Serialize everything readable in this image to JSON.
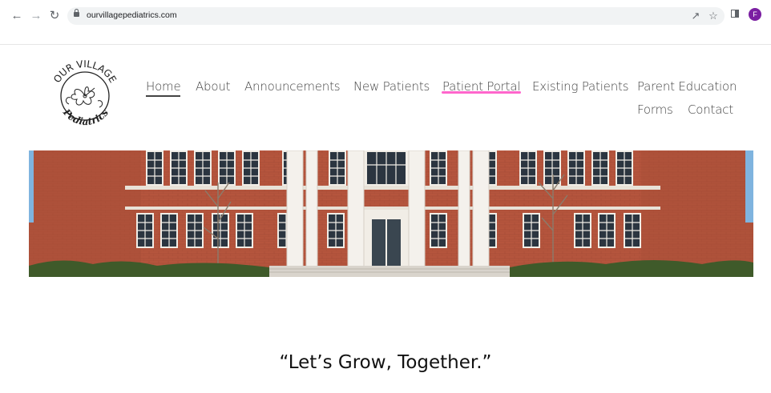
{
  "browser": {
    "url": "ourvillagepediatrics.com",
    "profile_initial": "F",
    "profile_color": "#7b1fa2",
    "icons": [
      "back-arrow-icon",
      "forward-arrow-icon",
      "reload-icon",
      "lock-icon",
      "share-icon",
      "star-icon",
      "side-panel-icon"
    ]
  },
  "site": {
    "logo": {
      "top_text": "OUR VILLAGE",
      "bottom_text": "Pediatrics"
    },
    "nav": {
      "home": "Home",
      "about": "About",
      "announcements": "Announcements",
      "new_patients": "New Patients",
      "patient_portal": "Patient Portal",
      "existing_patients": "Existing Patients",
      "parent_education": "Parent Education",
      "forms": "Forms",
      "contact": "Contact"
    },
    "tagline": "“Let’s Grow, Together.”",
    "colors": {
      "highlight": "#ff66cc",
      "brick": "#b5553d"
    }
  }
}
